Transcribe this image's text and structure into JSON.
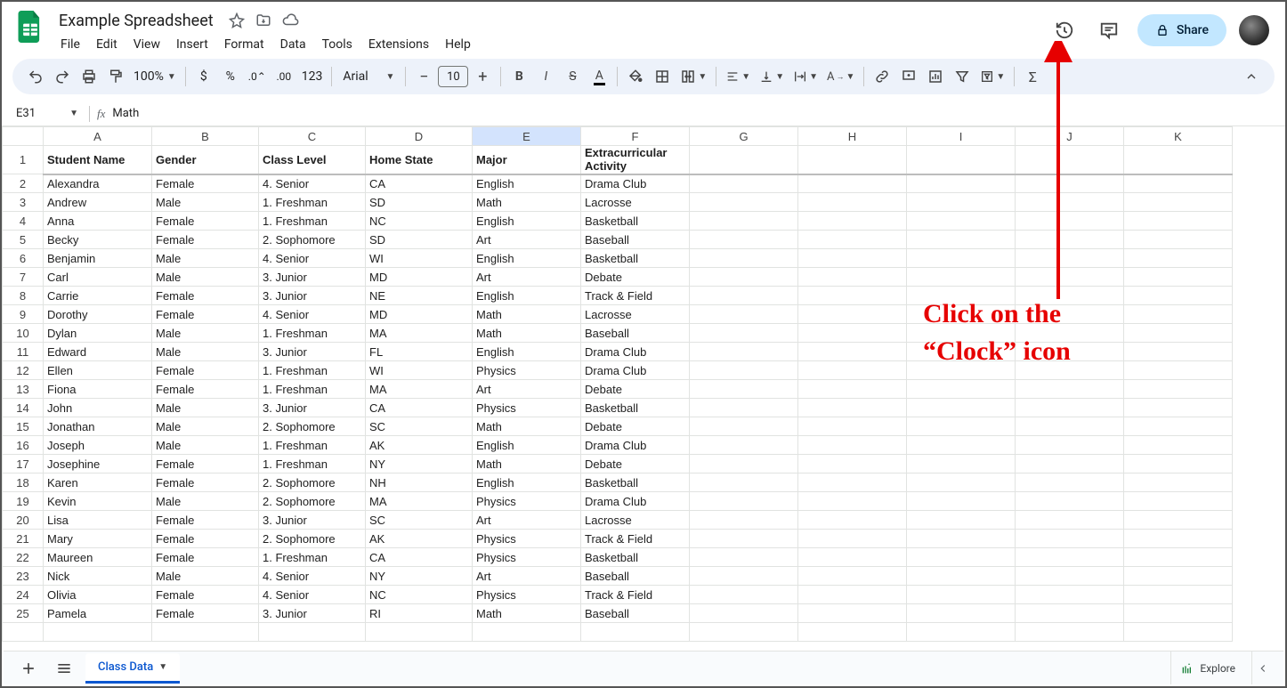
{
  "doc": {
    "title": "Example Spreadsheet"
  },
  "menus": [
    "File",
    "Edit",
    "View",
    "Insert",
    "Format",
    "Data",
    "Tools",
    "Extensions",
    "Help"
  ],
  "share": "Share",
  "toolbar": {
    "zoom": "100%",
    "font": "Arial",
    "size": "10",
    "fmt123": "123"
  },
  "namebox": "E31",
  "formula": "Math",
  "columns": [
    "A",
    "B",
    "C",
    "D",
    "E",
    "F",
    "G",
    "H",
    "I",
    "J",
    "K"
  ],
  "headers": [
    "Student Name",
    "Gender",
    "Class Level",
    "Home State",
    "Major",
    "Extracurricular Activity"
  ],
  "rows": [
    [
      "Alexandra",
      "Female",
      "4. Senior",
      "CA",
      "English",
      "Drama Club"
    ],
    [
      "Andrew",
      "Male",
      "1. Freshman",
      "SD",
      "Math",
      "Lacrosse"
    ],
    [
      "Anna",
      "Female",
      "1. Freshman",
      "NC",
      "English",
      "Basketball"
    ],
    [
      "Becky",
      "Female",
      "2. Sophomore",
      "SD",
      "Art",
      "Baseball"
    ],
    [
      "Benjamin",
      "Male",
      "4. Senior",
      "WI",
      "English",
      "Basketball"
    ],
    [
      "Carl",
      "Male",
      "3. Junior",
      "MD",
      "Art",
      "Debate"
    ],
    [
      "Carrie",
      "Female",
      "3. Junior",
      "NE",
      "English",
      "Track & Field"
    ],
    [
      "Dorothy",
      "Female",
      "4. Senior",
      "MD",
      "Math",
      "Lacrosse"
    ],
    [
      "Dylan",
      "Male",
      "1. Freshman",
      "MA",
      "Math",
      "Baseball"
    ],
    [
      "Edward",
      "Male",
      "3. Junior",
      "FL",
      "English",
      "Drama Club"
    ],
    [
      "Ellen",
      "Female",
      "1. Freshman",
      "WI",
      "Physics",
      "Drama Club"
    ],
    [
      "Fiona",
      "Female",
      "1. Freshman",
      "MA",
      "Art",
      "Debate"
    ],
    [
      "John",
      "Male",
      "3. Junior",
      "CA",
      "Physics",
      "Basketball"
    ],
    [
      "Jonathan",
      "Male",
      "2. Sophomore",
      "SC",
      "Math",
      "Debate"
    ],
    [
      "Joseph",
      "Male",
      "1. Freshman",
      "AK",
      "English",
      "Drama Club"
    ],
    [
      "Josephine",
      "Female",
      "1. Freshman",
      "NY",
      "Math",
      "Debate"
    ],
    [
      "Karen",
      "Female",
      "2. Sophomore",
      "NH",
      "English",
      "Basketball"
    ],
    [
      "Kevin",
      "Male",
      "2. Sophomore",
      "MA",
      "Physics",
      "Drama Club"
    ],
    [
      "Lisa",
      "Female",
      "3. Junior",
      "SC",
      "Art",
      "Lacrosse"
    ],
    [
      "Mary",
      "Female",
      "2. Sophomore",
      "AK",
      "Physics",
      "Track & Field"
    ],
    [
      "Maureen",
      "Female",
      "1. Freshman",
      "CA",
      "Physics",
      "Basketball"
    ],
    [
      "Nick",
      "Male",
      "4. Senior",
      "NY",
      "Art",
      "Baseball"
    ],
    [
      "Olivia",
      "Female",
      "4. Senior",
      "NC",
      "Physics",
      "Track & Field"
    ],
    [
      "Pamela",
      "Female",
      "3. Junior",
      "RI",
      "Math",
      "Baseball"
    ]
  ],
  "sheet_tab": "Class Data",
  "explore": "Explore",
  "selected_col": "E",
  "annotation": {
    "line1": "Click on the",
    "line2": "“Clock” icon"
  }
}
